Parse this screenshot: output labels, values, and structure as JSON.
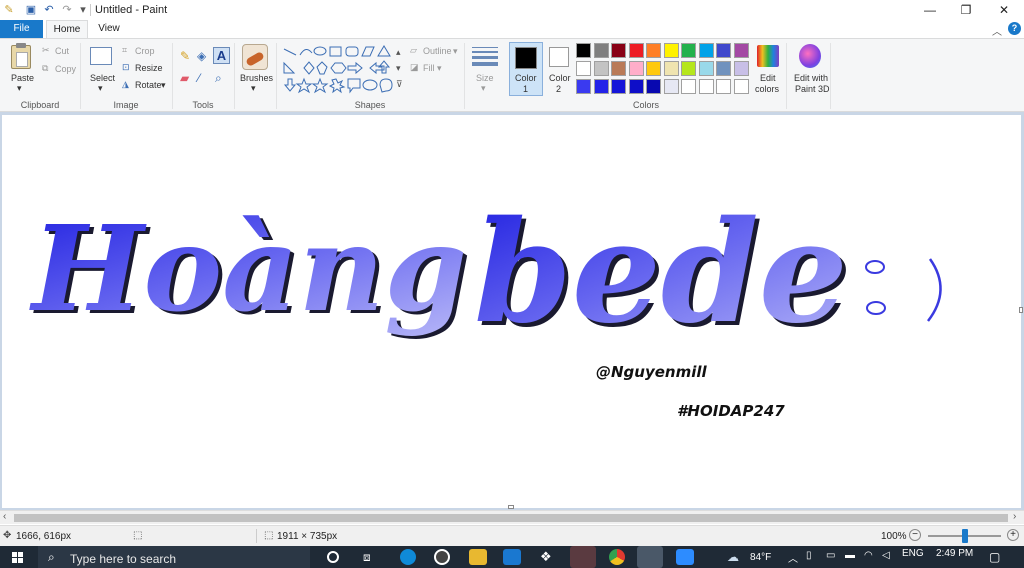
{
  "window": {
    "title": "Untitled - Paint"
  },
  "tabs": {
    "file": "File",
    "home": "Home",
    "view": "View"
  },
  "clipboard": {
    "paste": "Paste",
    "cut": "Cut",
    "copy": "Copy",
    "label": "Clipboard"
  },
  "image": {
    "select": "Select",
    "crop": "Crop",
    "resize": "Resize",
    "rotate": "Rotate",
    "label": "Image"
  },
  "tools": {
    "label": "Tools"
  },
  "brushes": {
    "label": "Brushes"
  },
  "shapes": {
    "outline": "Outline",
    "fill": "Fill",
    "label": "Shapes"
  },
  "size": {
    "label": "Size"
  },
  "colors": {
    "color1": "Color",
    "color1_num": "1",
    "color2": "Color",
    "color2_num": "2",
    "edit_colors_1": "Edit",
    "edit_colors_2": "colors",
    "edit3d_1": "Edit with",
    "edit3d_2": "Paint 3D",
    "label": "Colors",
    "palette_row1": [
      "#000000",
      "#7f7f7f",
      "#880015",
      "#ed1c24",
      "#ff7f27",
      "#fff200",
      "#22b14c",
      "#00a2e8",
      "#3f48cc",
      "#a349a4"
    ],
    "palette_row2": [
      "#ffffff",
      "#c3c3c3",
      "#b97a57",
      "#ffaec9",
      "#ffc90e",
      "#efe4b0",
      "#b5e61d",
      "#99d9ea",
      "#7092be",
      "#c8bfe7"
    ],
    "palette_row3": [
      "#3a3af0",
      "#2323e8",
      "#1515d8",
      "#0e0ec8",
      "#0808b0",
      "#e6e8f4",
      "#ffffff",
      "#ffffff",
      "#ffffff",
      "#ffffff"
    ]
  },
  "canvas": {
    "word1": "Hoàng",
    "word2": "bede",
    "emoticon": ":)",
    "credit": "@Nguyenmill",
    "hashtag": "#HOIDAP247",
    "stroke_color": "#2a2ad8"
  },
  "status": {
    "cursor_pos": "1666, 616px",
    "canvas_size": "1911 × 735px",
    "zoom": "100%"
  },
  "taskbar": {
    "search_placeholder": "Type here to search",
    "weather": "84°F",
    "lang": "ENG",
    "time": "2:49 PM"
  }
}
